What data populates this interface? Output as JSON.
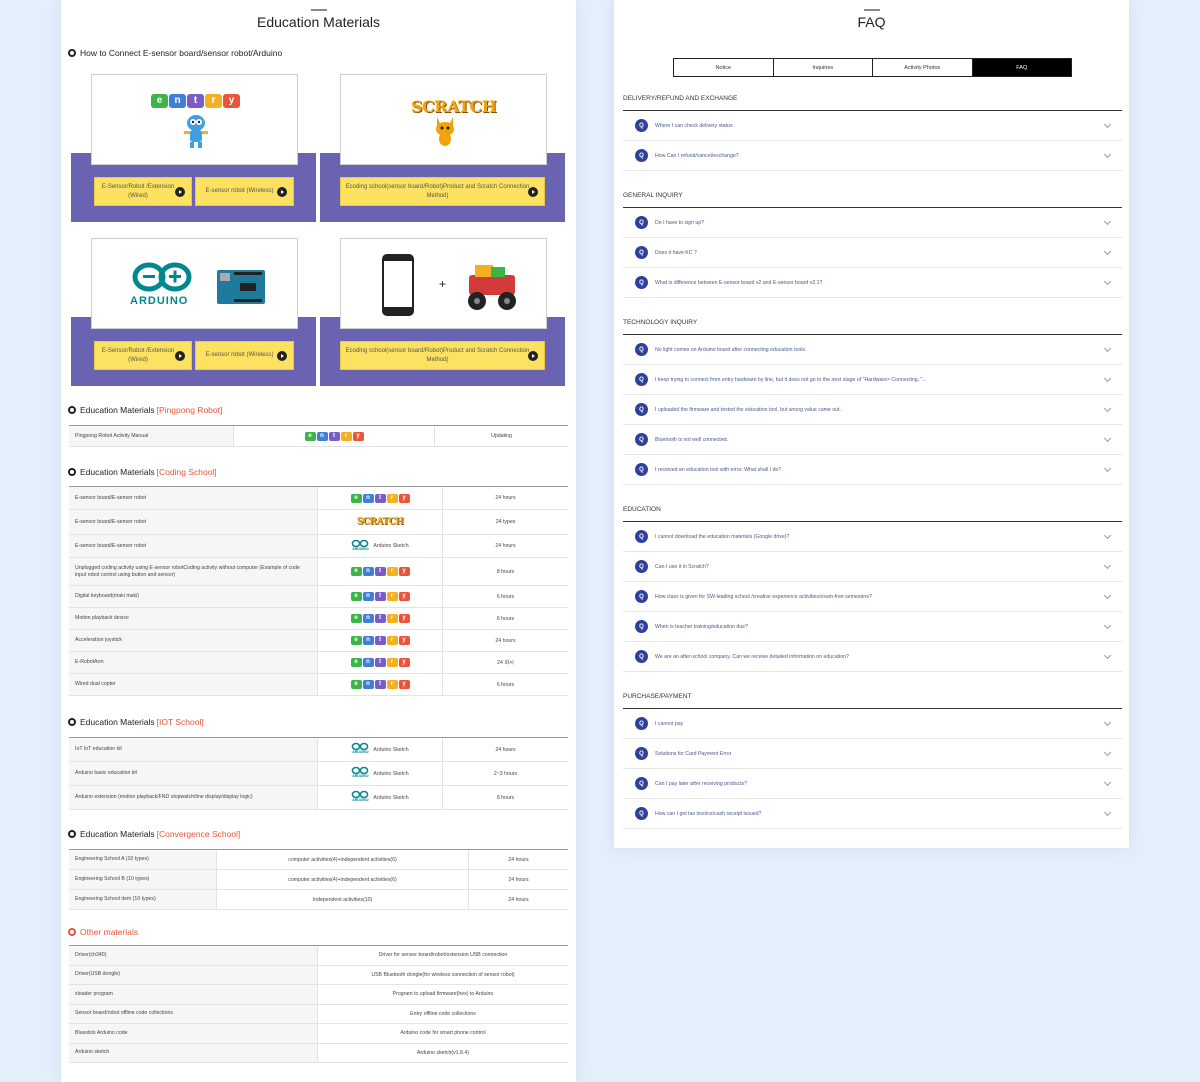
{
  "left": {
    "title": "Education Materials",
    "connect_heading": "How to Connect E-sensor board/sensor robot/Arduino",
    "cards": [
      {
        "buttons": [
          "E-Sensor/Robot /Extension (Wired)",
          "E-sensor robot (Wireless)"
        ]
      },
      {
        "buttons": [
          "Ecoding school(sensor board/Robot)Product and Scratch Connection Method)"
        ]
      },
      {
        "buttons": [
          "E-Sensor/Robot /Extension (Wired)",
          "E-sensor robot (Wireless)"
        ]
      },
      {
        "buttons": [
          "Ecoding school(sensor board/Robot)Product and Scratch Connection Method)"
        ]
      }
    ],
    "entry_letters": [
      "e",
      "n",
      "t",
      "r",
      "y"
    ],
    "entry_colors": [
      "#3bb54a",
      "#3f7fd9",
      "#7a5cc7",
      "#f4b021",
      "#e8553a"
    ],
    "scratch_logo": "SCRATCH",
    "arduino_logo": "ARDUINO",
    "arduino_small": "ARDUINO",
    "plus": "+",
    "sections": {
      "pingpong": {
        "label": "Education Materials",
        "tag": "[Pingpong Robot]",
        "rows": [
          {
            "name": "Pingpong Robot Activity Manual",
            "tool": "entry",
            "value": "Updating"
          }
        ]
      },
      "coding": {
        "label": "Education Materials",
        "tag": "[Coding School]",
        "rows": [
          {
            "name": "E-sensor board/E-sensor robot",
            "tool": "entry",
            "value": "24 hours"
          },
          {
            "name": "E-sensor board/E-sensor robot",
            "tool": "scratch",
            "value": "24 types"
          },
          {
            "name": "E-sensor board/E-sensor robot",
            "tool": "arduino",
            "tool_label": "Arduino Sketch",
            "value": "24 hours"
          },
          {
            "name": "Unplugged coding activity using E-sensor robotCoding activity without computer (Example of code input robot control using button and sensor)",
            "tool": "entry",
            "value": "8 hours"
          },
          {
            "name": "Digital keyboard(maki maki)",
            "tool": "entry",
            "value": "6 hours"
          },
          {
            "name": "Motion playback device",
            "tool": "entry",
            "value": "6 hours"
          },
          {
            "name": "Acceleration joystick",
            "tool": "entry",
            "value": "24 hours"
          },
          {
            "name": "E-RobotArm",
            "tool": "entry",
            "value": "24 회시"
          },
          {
            "name": "Wired dual copter",
            "tool": "entry",
            "value": "6 hours"
          }
        ]
      },
      "iot": {
        "label": "Education Materials",
        "tag": "[IOT School]",
        "rows": [
          {
            "name": "IoT IoT education kit",
            "tool": "arduino",
            "tool_label": "Arduino Sketch",
            "value": "24 hours"
          },
          {
            "name": "Arduino basic education kit",
            "tool": "arduino",
            "tool_label": "Arduino Sketch",
            "value": "2~3 hours"
          },
          {
            "name": "Arduino extension (motion playback/FND stopwatch/line display/display logic)",
            "tool": "arduino",
            "tool_label": "Arduino Sketch",
            "value": "6 hours"
          }
        ]
      },
      "convergence": {
        "label": "Education Materials",
        "tag": "[Convergence School]",
        "rows": [
          {
            "name": "Engineering School A (10 types)",
            "mid": "computer activities(4)+independent activities(6)",
            "value": "24 hours"
          },
          {
            "name": "Engineering School B (10 types)",
            "mid": "computer activities(4)+independent activities(6)",
            "value": "24 hours"
          },
          {
            "name": "Engineering School item (10 types)",
            "mid": "Independent activities(10)",
            "value": "24 hours"
          }
        ]
      },
      "other": {
        "label": "Other materials",
        "rows": [
          {
            "name": "Driver(ch340)",
            "desc": "Driver for sensor board/robot/extension USB connection"
          },
          {
            "name": "Driver(USB dongle)",
            "desc": "USB Bluetooth dongle(for wireless connection of sensor robot)"
          },
          {
            "name": "xloader program",
            "desc": "Program to upload firmware(hex) to Arduino"
          },
          {
            "name": "Sensor board/robot offline code collections",
            "desc": "Entry offline code collections"
          },
          {
            "name": "Bluestick Arduino code",
            "desc": "Arduino code for smart phone control"
          },
          {
            "name": "Arduino sketch",
            "desc": "Arduino sketch(v1.8.4)"
          }
        ]
      }
    }
  },
  "right": {
    "title": "FAQ",
    "tabs": [
      "Notice",
      "Inquiries",
      "Activity Photos",
      "FAQ"
    ],
    "q_badge": "Q",
    "categories": [
      {
        "title": "DELIVERY/REFUND AND EXCHANGE",
        "items": [
          "Where I can check delivery status",
          "How Can I refund/cancel/exchange?"
        ]
      },
      {
        "title": "GENERAL INQUIRY",
        "items": [
          "Do I have to sign up?",
          "Does it have KC ?",
          "What is difference between E-sensor board v2 and E-sensor board v2.1?"
        ]
      },
      {
        "title": "TECHNOLOGY INQUIRY",
        "items": [
          "No light comes on Arduino board after connecting education tools.",
          "I keep trying to connect from entry hardware by line, but it does not go to the next stage of \"Hardware> Connecting..\"...",
          "I uploaded the firmware and tested the education tool, but wrong value came out.",
          "Bluetooth is not well connected.",
          "I received an education tool with error. What shall I do?"
        ]
      },
      {
        "title": "EDUCATION",
        "items": [
          "I cannot download the education materials (Google drive)?",
          "Can I use it in Scratch?",
          "How class is given for SW-leading school /creative experience activities/exam-free semesters?",
          "When is teacher training/education due?",
          "We are an after-school company. Can we receive detailed information on education?"
        ]
      },
      {
        "title": "PURCHASE/PAYMENT",
        "items": [
          "I cannot pay",
          "Solutions for Card Payment Error",
          "Can I pay later after receiving products?",
          "How can I get tax invoice/cash receipt issued?"
        ]
      }
    ]
  }
}
